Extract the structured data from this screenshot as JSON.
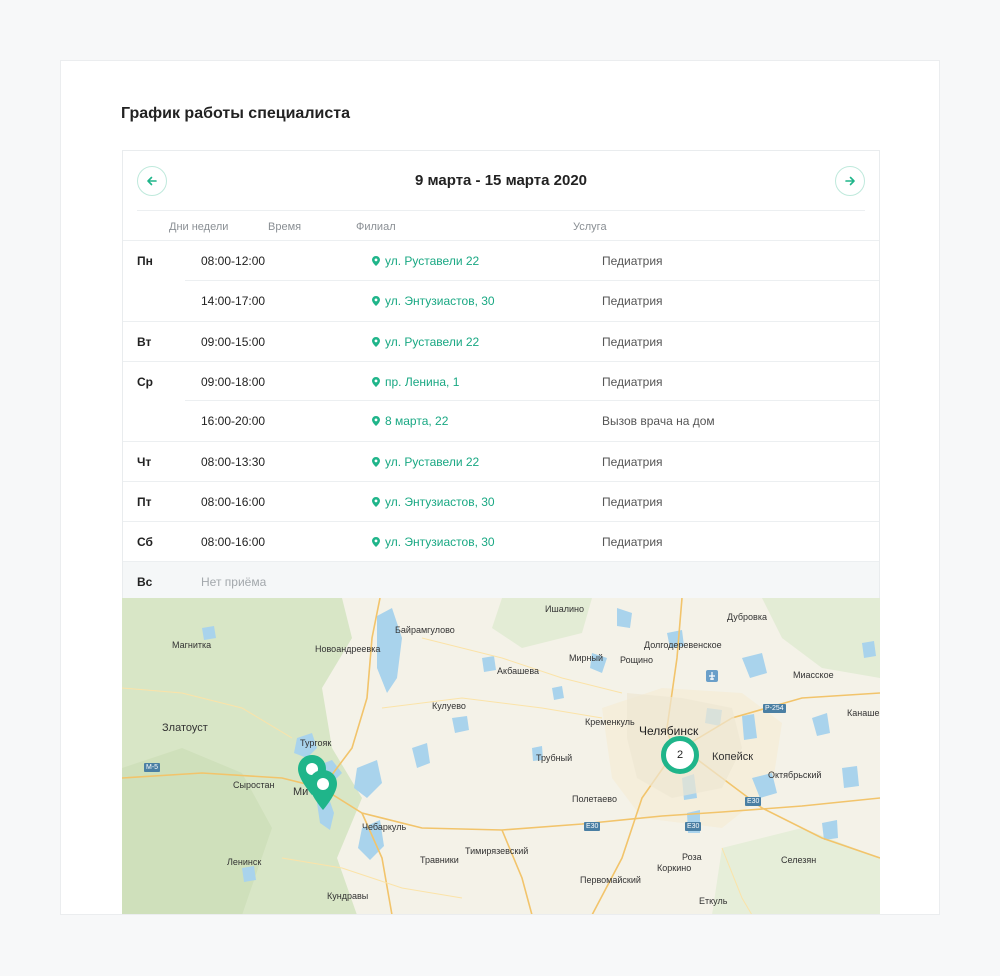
{
  "page": {
    "title": "График работы специалиста"
  },
  "schedule": {
    "week_label": "9 марта - 15 марта 2020",
    "columns": {
      "day": "Дни недели",
      "time": "Время",
      "branch": "Филиал",
      "service": "Услуга"
    },
    "rows": [
      {
        "day": "Пн",
        "time": "08:00-12:00",
        "branch": "ул. Руставели 22",
        "service": "Педиатрия"
      },
      {
        "day": "",
        "time": "14:00-17:00",
        "branch": "ул. Энтузиастов, 30",
        "service": "Педиатрия"
      },
      {
        "day": "Вт",
        "time": "09:00-15:00",
        "branch": "ул. Руставели 22",
        "service": "Педиатрия"
      },
      {
        "day": "Ср",
        "time": "09:00-18:00",
        "branch": "пр. Ленина, 1",
        "service": "Педиатрия"
      },
      {
        "day": "",
        "time": "16:00-20:00",
        "branch": "8 марта, 22",
        "service": "Вызов врача на дом"
      },
      {
        "day": "Чт",
        "time": "08:00-13:30",
        "branch": "ул. Руставели 22",
        "service": "Педиатрия"
      },
      {
        "day": "Пт",
        "time": "08:00-16:00",
        "branch": "ул. Энтузиастов, 30",
        "service": "Педиатрия"
      },
      {
        "day": "Сб",
        "time": "08:00-16:00",
        "branch": "ул. Энтузиастов, 30",
        "service": "Педиатрия"
      }
    ],
    "day_off": {
      "day": "Вс",
      "text": "Нет приёма"
    }
  },
  "map": {
    "places": {
      "ishalino": "Ишалино",
      "dubrovka": "Дубровка",
      "bairamgulovo": "Байрамгулово",
      "novoandreevka": "Новоандреевка",
      "magnitka": "Магнитка",
      "dolgoderevenskoe": "Долгодеревенское",
      "akbasheva": "Акбашева",
      "mirny": "Мирный",
      "roshchino": "Рощино",
      "miasskoe": "Миасское",
      "kanashevo": "Канашево",
      "kuluevo": "Кулуево",
      "kremenkul": "Кременкуль",
      "zlatoust": "Златоуст",
      "chelyabinsk": "Челябинск",
      "turgoyak": "Тургояк",
      "kopeysk": "Копейск",
      "trubny": "Трубный",
      "oktyabrsky": "Октябрьский",
      "syrostan": "Сыростан",
      "miass_partial": "Ми",
      "poletaevo": "Полетаево",
      "chebarkul": "Чебаркуль",
      "timiryazevsky": "Тимирязевский",
      "travniki": "Травники",
      "roza": "Роза",
      "lenninsk": "Ленинск",
      "pervomaisky": "Первомайский",
      "korkino": "Коркино",
      "seleznyan": "Селезян",
      "kundravy": "Кундравы",
      "etkul": "Еткуль"
    },
    "routes": {
      "m5": "М-5",
      "e30a": "Е30",
      "e30b": "Е30",
      "e30c": "Е30",
      "p254": "Р-254"
    },
    "cluster_count": "2",
    "colors": {
      "accent": "#1fb58a",
      "water": "#a9d3ec",
      "forest": "#d6e5c4"
    }
  }
}
